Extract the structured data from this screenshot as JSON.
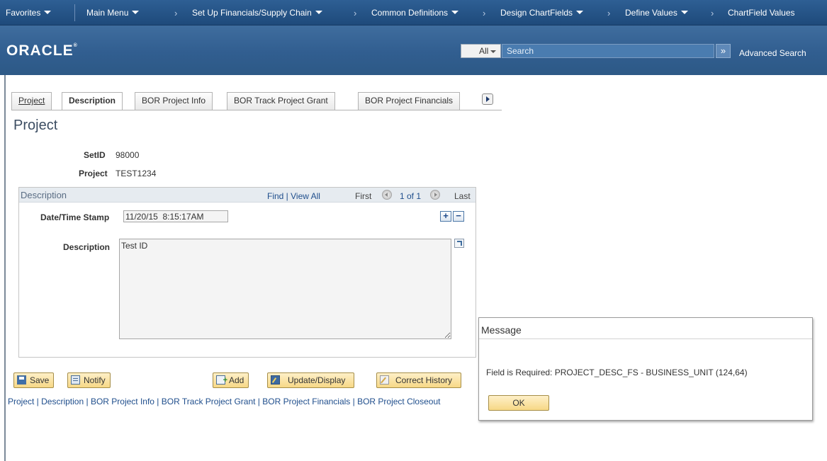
{
  "nav": {
    "favorites": "Favorites",
    "main_menu": "Main Menu",
    "breadcrumbs": [
      "Set Up Financials/Supply Chain",
      "Common Definitions",
      "Design ChartFields",
      "Define Values",
      "ChartField Values"
    ]
  },
  "header": {
    "logo": "ORACLE",
    "search_scope": "All",
    "search_placeholder": "Search",
    "advanced_search": "Advanced Search"
  },
  "tabs": [
    {
      "label": "Project",
      "active": false
    },
    {
      "label": "Description",
      "active": true
    },
    {
      "label": "BOR Project Info",
      "active": false
    },
    {
      "label": "BOR Track Project Grant",
      "active": false
    },
    {
      "label": "BOR Project Financials",
      "active": false
    }
  ],
  "page": {
    "title": "Project",
    "setid_label": "SetID",
    "setid_value": "98000",
    "project_label": "Project",
    "project_value": "TEST1234"
  },
  "desc_box": {
    "title": "Description",
    "find_view": "Find | View All",
    "first": "First",
    "pager": "1 of 1",
    "last": "Last",
    "dts_label": "Date/Time Stamp",
    "dts_value": "11/20/15  8:15:17AM",
    "desc_label": "Description",
    "desc_value": "Test ID"
  },
  "toolbar": {
    "save": "Save",
    "notify": "Notify",
    "add": "Add",
    "update": "Update/Display",
    "history": "Correct History"
  },
  "footer_links": "Project | Description | BOR Project Info | BOR Track Project Grant | BOR Project Financials | BOR Project Closeout",
  "dialog": {
    "title": "Message",
    "message": "Field is Required:  PROJECT_DESC_FS - BUSINESS_UNIT (124,64)",
    "ok": "OK"
  }
}
